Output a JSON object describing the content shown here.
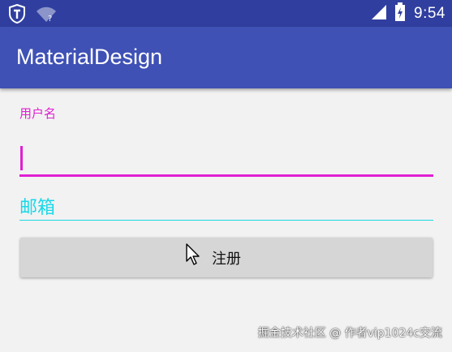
{
  "status_bar": {
    "time": "9:54",
    "icons": [
      "shield-app-icon",
      "wifi-unknown-icon",
      "signal-icon",
      "battery-charging-icon"
    ]
  },
  "app_bar": {
    "title": "MaterialDesign"
  },
  "form": {
    "username_label": "用户名",
    "username_value": "",
    "email_hint": "邮箱",
    "register_label": "注册"
  },
  "watermark": "掘金技术社区 @ 作者vip1024c交流",
  "colors": {
    "status_bar": "#303f9f",
    "primary": "#3f51b5",
    "accent_username": "#e01fd2",
    "accent_email": "#19d8e8",
    "button": "#d6d6d6",
    "background": "#f2f2f2"
  }
}
